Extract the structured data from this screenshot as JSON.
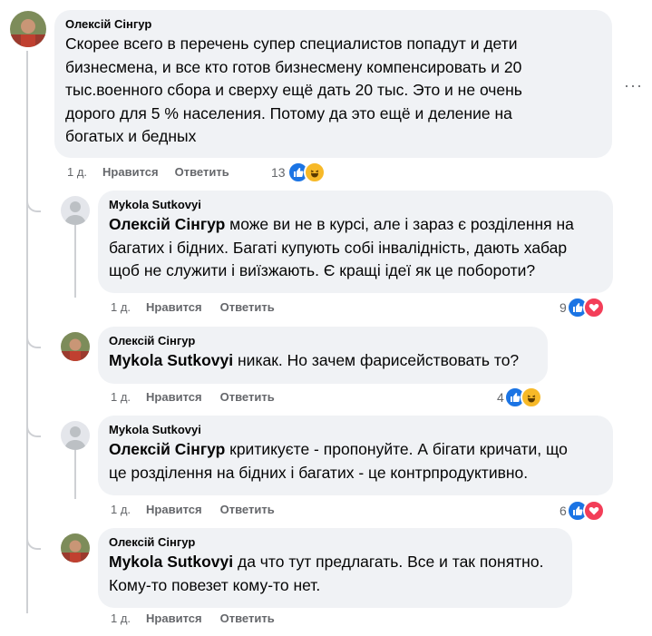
{
  "comments": [
    {
      "author": "Олексій Сінгур",
      "lines": [
        "Скорее всего в перечень супер специалистов попадут и дети",
        "бизнесмена, и все кто готов бизнесмену компенсировать и 20",
        "тыс.военного сбора и сверху ещё дать 20 тыс. Это и не очень",
        "дорого для 5 % населения. Потому да это ещё и деление на",
        "богатых и бедных"
      ],
      "age": "1 д.",
      "like_label": "Нравится",
      "reply_label": "Ответить",
      "reaction_count": "13",
      "reactions": [
        "like-icon",
        "haha-icon"
      ]
    },
    {
      "author": "Mykola Sutkovyi",
      "mention": "Олексій Сінгур",
      "lines": [
        " може ви не в курсі, але і зараз є розділення на",
        "багатих і бідних. Багаті купують собі інвалідність, дають хабар",
        "щоб не служити і виїзжають. Є кращі ідеї як це побороти?"
      ],
      "age": "1 д.",
      "like_label": "Нравится",
      "reply_label": "Ответить",
      "reaction_count": "9",
      "reactions": [
        "like-icon",
        "heart-icon"
      ]
    },
    {
      "author": "Олексій Сінгур",
      "mention": "Mykola Sutkovyi",
      "lines": [
        " никак. Но зачем фарисействовать то?"
      ],
      "age": "1 д.",
      "like_label": "Нравится",
      "reply_label": "Ответить",
      "reaction_count": "4",
      "reactions": [
        "like-icon",
        "haha-icon"
      ]
    },
    {
      "author": "Mykola Sutkovyi",
      "mention": "Олексій Сінгур",
      "lines": [
        " критикуєте - пропонуйте. А бігати кричати, що",
        "це розділення на бідних і багатих - це контрпродуктивно."
      ],
      "age": "1 д.",
      "like_label": "Нравится",
      "reply_label": "Ответить",
      "reaction_count": "6",
      "reactions": [
        "like-icon",
        "heart-icon"
      ]
    },
    {
      "author": "Олексій Сінгур",
      "mention": "Mykola Sutkovyi",
      "lines": [
        " да что тут предлагать. Все и так понятно.",
        "Кому-то повезет кому-то нет."
      ],
      "age": "1 д.",
      "like_label": "Нравится",
      "reply_label": "Ответить"
    }
  ],
  "more_label": "···",
  "colors": {
    "bubble": "#f0f2f5",
    "meta": "#65676b",
    "like": "#1b74e4",
    "heart": "#f33e58",
    "haha": "#f7b928"
  }
}
